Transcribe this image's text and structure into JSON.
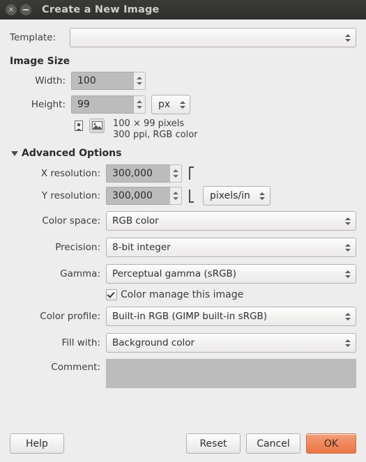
{
  "window": {
    "title": "Create a New Image",
    "close_icon": "close-icon",
    "minimize_icon": "minimize-icon"
  },
  "template": {
    "label": "Template:",
    "value": "",
    "placeholder": ""
  },
  "image_size": {
    "heading": "Image Size",
    "width_label": "Width:",
    "width_value": "100",
    "height_label": "Height:",
    "height_value": "99",
    "unit_value": "px",
    "orientation": {
      "portrait_icon": "portrait-orientation-icon",
      "landscape_icon": "landscape-orientation-icon",
      "selected": "landscape"
    },
    "info_line_1": "100 × 99 pixels",
    "info_line_2": "300 ppi, RGB color"
  },
  "advanced": {
    "heading": "Advanced Options",
    "expander_icon": "triangle-down-icon",
    "x_resolution_label": "X resolution:",
    "x_resolution_value": "300,000",
    "y_resolution_label": "Y resolution:",
    "y_resolution_value": "300,000",
    "chain_icon": "chain-linked-icon",
    "resolution_unit": "pixels/in",
    "color_space_label": "Color space:",
    "color_space_value": "RGB color",
    "precision_label": "Precision:",
    "precision_value": "8-bit integer",
    "gamma_label": "Gamma:",
    "gamma_value": "Perceptual gamma (sRGB)",
    "color_manage_label": "Color manage this image",
    "color_manage_checked": true,
    "color_profile_label": "Color profile:",
    "color_profile_value": "Built-in RGB (GIMP built-in sRGB)",
    "fill_with_label": "Fill with:",
    "fill_with_value": "Background color",
    "comment_label": "Comment:",
    "comment_value": ""
  },
  "buttons": {
    "help": "Help",
    "reset": "Reset",
    "cancel": "Cancel",
    "ok": "OK"
  },
  "colors": {
    "window_bg": "#ededed",
    "titlebar_bg": "#2f2f2d",
    "title_text": "#cfcfcb",
    "label_text": "#3c3c3c",
    "entry_fill": "#bcbcbc",
    "ok_accent": "#ef8a5f"
  }
}
